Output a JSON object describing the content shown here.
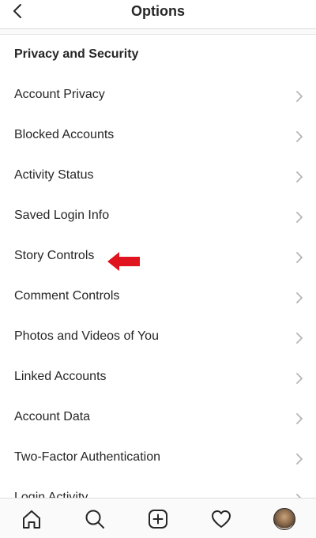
{
  "header": {
    "title": "Options",
    "back_icon": "chevron-left-icon"
  },
  "section": {
    "title": "Privacy and Security"
  },
  "items": [
    {
      "label": "Account Privacy"
    },
    {
      "label": "Blocked Accounts"
    },
    {
      "label": "Activity Status"
    },
    {
      "label": "Saved Login Info"
    },
    {
      "label": "Story Controls"
    },
    {
      "label": "Comment Controls"
    },
    {
      "label": "Photos and Videos of You"
    },
    {
      "label": "Linked Accounts"
    },
    {
      "label": "Account Data"
    },
    {
      "label": "Two-Factor Authentication"
    },
    {
      "label": "Login Activity"
    }
  ],
  "annotation": {
    "arrow_color": "#e0141e",
    "icon": "red-arrow-icon"
  },
  "tabbar": {
    "tabs": [
      {
        "icon": "home-icon"
      },
      {
        "icon": "search-icon"
      },
      {
        "icon": "add-post-icon"
      },
      {
        "icon": "heart-icon"
      },
      {
        "icon": "profile-avatar"
      }
    ]
  }
}
